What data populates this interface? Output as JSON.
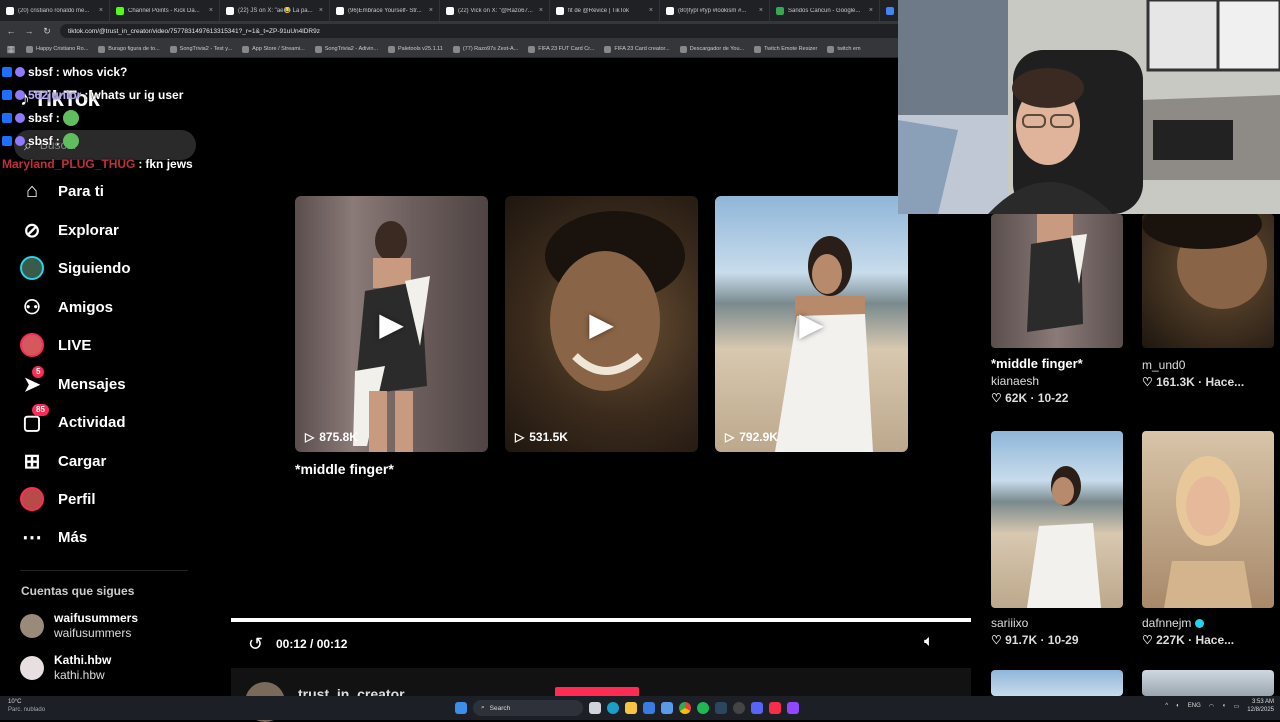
{
  "browser": {
    "tabs": [
      {
        "label": "(20) cristiano ronaldo me...",
        "icon": "x-icon",
        "color": "#ffffff"
      },
      {
        "label": "Channel Points - Kick Da...",
        "icon": "kick-icon",
        "color": "#53fc18"
      },
      {
        "label": "(22) JS on X: \"ae😂 La pa...",
        "icon": "x-icon",
        "color": "#ffffff"
      },
      {
        "label": "(96)Embrace Yourself- Str...",
        "icon": "tiktok-icon",
        "color": "#ffffff"
      },
      {
        "label": "(22) Vick on X: \"@Razo67...",
        "icon": "x-icon",
        "color": "#ffffff"
      },
      {
        "label": "fit de @Revice | TikTok",
        "icon": "tiktok-icon",
        "color": "#ffffff"
      },
      {
        "label": "(80)fypl #fyp #lookism #...",
        "icon": "tiktok-icon",
        "color": "#ffffff"
      },
      {
        "label": "Sandos Cancun - Google...",
        "icon": "maps-icon",
        "color": "#34a853"
      },
      {
        "label": "clima - Bu...",
        "icon": "google-icon",
        "color": "#4285f4"
      }
    ],
    "url": "tiktok.com/@trust_in_creator/video/7577831497613315341?_r=1&_t=ZP-91uUn4lDR9z",
    "bookmarks": [
      "Happy Cristiano Ro...",
      "Burago figura de to...",
      "SongTrivia2 - Test y...",
      "App Store / Streami...",
      "SongTrivia2 - Adivin...",
      "Paletools v25.1.11",
      "(77) Razo97s Zest-A...",
      "FIFA 23 FUT Card Cr...",
      "FIFA 23 Card creator...",
      "Descargador de You...",
      "Twitch Emote Resizer",
      "twitch em"
    ]
  },
  "sidebar": {
    "logo": "TikTok",
    "search_placeholder": "Buscar",
    "nav": [
      {
        "label": "Para ti",
        "icon": "home-icon"
      },
      {
        "label": "Explorar",
        "icon": "compass-icon"
      },
      {
        "label": "Siguiendo",
        "icon": "avatar-icon"
      },
      {
        "label": "Amigos",
        "icon": "friends-icon"
      },
      {
        "label": "LIVE",
        "icon": "live-avatar-icon"
      },
      {
        "label": "Mensajes",
        "icon": "send-icon",
        "badge": "5"
      },
      {
        "label": "Actividad",
        "icon": "inbox-icon",
        "badge": "85"
      },
      {
        "label": "Cargar",
        "icon": "plus-square-icon"
      },
      {
        "label": "Perfil",
        "icon": "profile-avatar-icon"
      },
      {
        "label": "Más",
        "icon": "more-icon"
      }
    ],
    "following_title": "Cuentas que sigues",
    "following": [
      {
        "name": "waifusummers",
        "handle": "waifusummers"
      },
      {
        "name": "Kathi.hbw",
        "handle": "kathi.hbw"
      }
    ]
  },
  "chat": [
    {
      "user": "sbsf",
      "message": "whos vick?",
      "user_color": "#ffffff"
    },
    {
      "user": "562junior",
      "message": "whats ur ig user",
      "user_color": "#b9a8ff"
    },
    {
      "user": "sbsf",
      "message": "",
      "user_color": "#ffffff",
      "emote": true
    },
    {
      "user": "sbsf",
      "message": "",
      "user_color": "#ffffff",
      "emote": true
    },
    {
      "user": "Maryland_PLUG_THUG",
      "message": "fkn jews",
      "user_color": "#c0303a"
    }
  ],
  "main": {
    "cards": [
      {
        "views": "875.8K"
      },
      {
        "views": "531.5K"
      },
      {
        "views": "792.9K"
      }
    ],
    "first_card_title": "*middle finger*",
    "time": "00:12 / 00:12",
    "progress": 1.0,
    "creator": "trust_in_creator"
  },
  "right": {
    "items": [
      {
        "title": "*middle finger*",
        "user": "kianaesh",
        "likes": "62K",
        "date": "10-22",
        "verified": false
      },
      {
        "title": "",
        "user": "m_und0",
        "likes": "161.3K",
        "date": "Hace...",
        "verified": false
      },
      {
        "title": "",
        "user": "sariiixo",
        "likes": "91.7K",
        "date": "10-29",
        "verified": false
      },
      {
        "title": "",
        "user": "dafnnejm",
        "likes": "227K",
        "date": "Hace...",
        "verified": true
      }
    ]
  },
  "taskbar": {
    "weather_temp": "10°C",
    "weather_desc": "Parc. nublado",
    "search": "Search",
    "lang": "ENG",
    "time": "3:53 AM",
    "date": "12/8/2025"
  },
  "colors": {
    "accent": "#fe2c55",
    "verified": "#20d5ec"
  }
}
